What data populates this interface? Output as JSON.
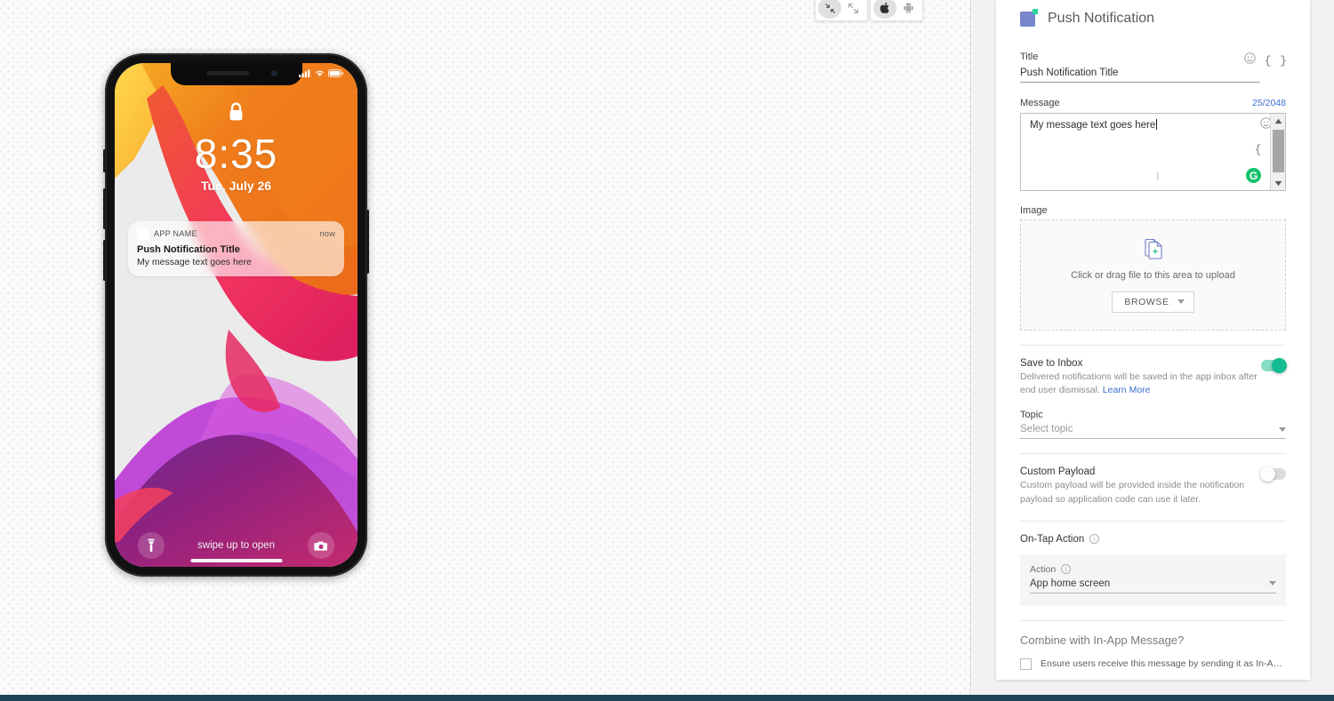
{
  "toolbars": {
    "zoom": [
      {
        "name": "zoom-out",
        "icon": "contract-arrows-icon",
        "active": true
      },
      {
        "name": "zoom-in",
        "icon": "expand-arrows-icon",
        "active": false
      }
    ],
    "platform": [
      {
        "name": "ios",
        "icon": "apple-icon",
        "active": true
      },
      {
        "name": "android",
        "icon": "android-icon",
        "active": false
      }
    ]
  },
  "phone": {
    "status": {
      "signal": "signal-bars-icon",
      "wifi": "wifi-icon",
      "battery": "battery-icon"
    },
    "lock_icon": "lock-icon",
    "clock": "8:35",
    "date": "Tue, July 26",
    "notification": {
      "app_icon": "app-icon-placeholder",
      "app_name": "APP NAME",
      "time": "now",
      "title": "Push Notification Title",
      "body": "My message text goes here"
    },
    "flashlight_icon": "flashlight-icon",
    "camera_icon": "camera-icon",
    "swipe_text": "swipe up to open"
  },
  "panel": {
    "header": {
      "icon": "push-notification-icon",
      "title": "Push Notification"
    },
    "title_field": {
      "label": "Title",
      "value": "Push Notification Title",
      "emoji_icon": "emoji-icon",
      "braces_icon": "curly-braces-icon"
    },
    "message_field": {
      "label": "Message",
      "counter": "25/2048",
      "value": "My message text goes here",
      "emoji_icon": "emoji-icon",
      "braces_icon": "curly-braces-icon",
      "grammarly": "G",
      "scroll_up_icon": "scroll-up-arrow-icon",
      "scroll_down_icon": "scroll-down-arrow-icon"
    },
    "image_field": {
      "label": "Image",
      "upload_icon": "file-add-icon",
      "hint": "Click or drag file to this area to upload",
      "browse_label": "BROWSE"
    },
    "save_to_inbox": {
      "title": "Save to Inbox",
      "description": "Delivered notifications will be saved in the app inbox after end user dismissal.",
      "link": "Learn More",
      "enabled": true
    },
    "topic": {
      "label": "Topic",
      "placeholder": "Select topic"
    },
    "custom_payload": {
      "title": "Custom Payload",
      "description": "Custom payload will be provided inside the notification payload so application code can use it later.",
      "enabled": false
    },
    "on_tap_action": {
      "label": "On-Tap Action",
      "action_label": "Action",
      "action_value": "App home screen"
    },
    "combine": {
      "title": "Combine with In-App Message?",
      "checkbox_label": "Ensure users receive this message by sending it as In-App if they …",
      "checked": false
    }
  },
  "colors": {
    "accent_blue": "#3b6ecf",
    "toggle_on": "#14bb93",
    "grammarly_green": "#15c26b",
    "header_icon": "#7985cd",
    "bottom_bar": "#1e4659"
  }
}
